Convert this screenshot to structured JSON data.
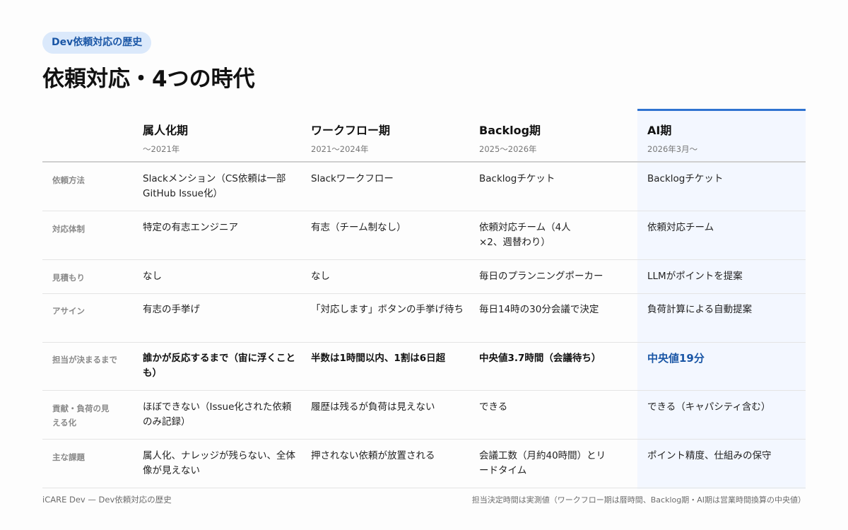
{
  "badge": "Dev依頼対応の歴史",
  "title": "依頼対応・4つの時代",
  "columns": [
    {
      "name": "属人化期",
      "period": "〜2021年"
    },
    {
      "name": "ワークフロー期",
      "period": "2021〜2024年"
    },
    {
      "name": "Backlog期",
      "period": "2025〜2026年"
    },
    {
      "name": "AI期",
      "period": "2026年3月〜"
    }
  ],
  "rows": [
    {
      "label": "依頼方法",
      "cells": [
        "Slackメンション（CS依頼は一部GitHub Issue化）",
        "Slackワークフロー",
        "Backlogチケット",
        "Backlogチケット"
      ]
    },
    {
      "label": "対応体制",
      "cells": [
        "特定の有志エンジニア",
        "有志（チーム制なし）",
        "依頼対応チーム（4人×2、週替わり）",
        "依頼対応チーム"
      ]
    },
    {
      "label": "見積もり",
      "cells": [
        "なし",
        "なし",
        "毎日のプランニングポーカー",
        "LLMがポイントを提案"
      ]
    },
    {
      "label": "アサイン",
      "cells": [
        "有志の手挙げ",
        "「対応します」ボタンの手挙げ待ち",
        "毎日14時の30分会議で決定",
        "負荷計算による自動提案"
      ]
    },
    {
      "label": "担当が決まるまで",
      "cells": [
        "誰かが反応するまで（宙に浮くことも）",
        "半数は1時間以内、1割は6日超",
        "中央値3.7時間（会議待ち）",
        "中央値19分"
      ]
    },
    {
      "label": "貢献・負荷の見える化",
      "cells": [
        "ほぼできない（Issue化された依頼のみ記録）",
        "履歴は残るが負荷は見えない",
        "できる",
        "できる（キャパシティ含む）"
      ]
    },
    {
      "label": "主な課題",
      "cells": [
        "属人化、ナレッジが残らない、全体像が見えない",
        "押されない依頼が放置される",
        "会議工数（月約40時間）とリードタイム",
        "ポイント精度、仕組みの保守"
      ]
    }
  ],
  "footer": {
    "left": "iCARE Dev — Dev依頼対応の歴史",
    "right": "担当決定時間は実測値（ワークフロー期は暦時間、Backlog期・AI期は営業時間換算の中央値）"
  },
  "colors": {
    "accent": "#2f73d1",
    "accent_text": "#1a56a6",
    "badge_bg": "#dbe9fb",
    "ai_column_bg": "#f3f7ff"
  }
}
